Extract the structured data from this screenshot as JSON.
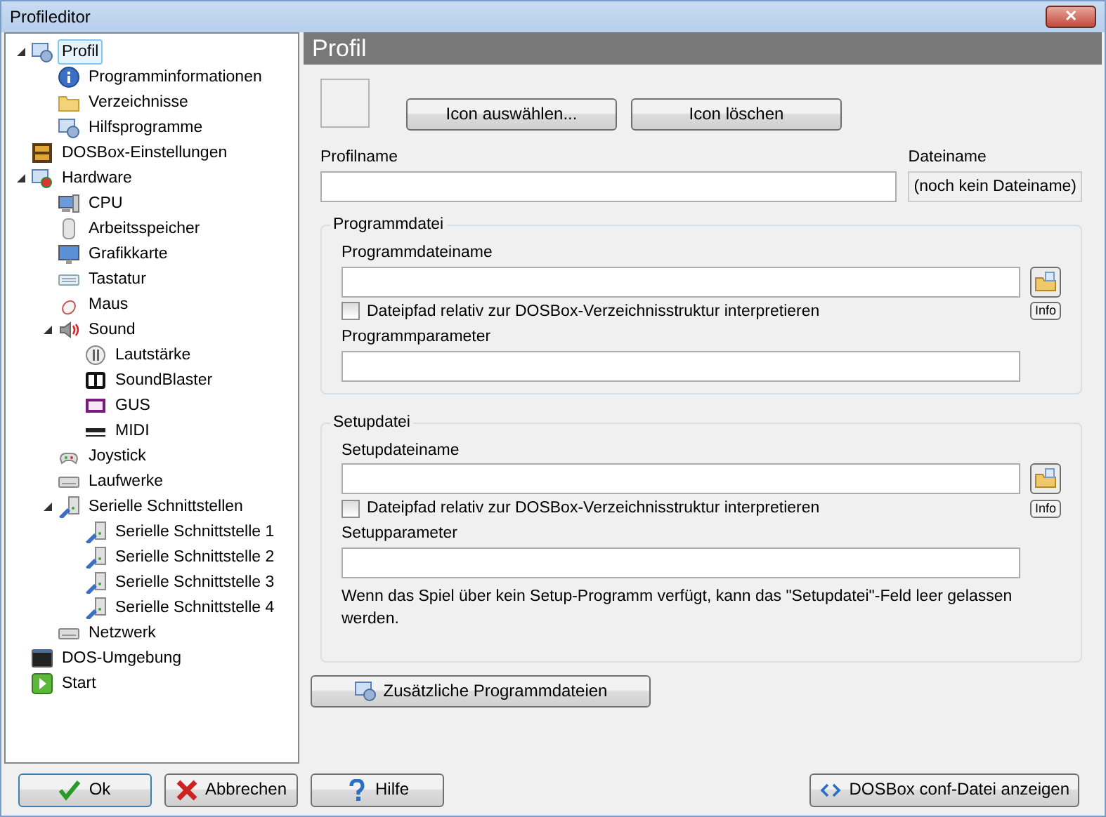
{
  "window": {
    "title": "Profileditor",
    "close_label": "✕"
  },
  "tree": [
    {
      "label": "Profil",
      "kind": "gear",
      "selected": true,
      "expanded": true,
      "children": [
        {
          "label": "Programminformationen",
          "kind": "info",
          "selected": false
        },
        {
          "label": "Verzeichnisse",
          "kind": "folder",
          "selected": false
        },
        {
          "label": "Hilfsprogramme",
          "kind": "gear",
          "selected": false
        }
      ]
    },
    {
      "label": "DOSBox-Einstellungen",
      "kind": "dosbox",
      "selected": false
    },
    {
      "label": "Hardware",
      "kind": "hardware",
      "selected": false,
      "expanded": true,
      "children": [
        {
          "label": "CPU",
          "kind": "computer",
          "selected": false
        },
        {
          "label": "Arbeitsspeicher",
          "kind": "memory",
          "selected": false
        },
        {
          "label": "Grafikkarte",
          "kind": "monitor",
          "selected": false
        },
        {
          "label": "Tastatur",
          "kind": "keyboard",
          "selected": false
        },
        {
          "label": "Maus",
          "kind": "mouse",
          "selected": false
        },
        {
          "label": "Sound",
          "kind": "speaker",
          "selected": false,
          "expanded": true,
          "children": [
            {
              "label": "Lautstärke",
              "kind": "volume",
              "selected": false
            },
            {
              "label": "SoundBlaster",
              "kind": "sb",
              "selected": false
            },
            {
              "label": "GUS",
              "kind": "gus",
              "selected": false
            },
            {
              "label": "MIDI",
              "kind": "midi",
              "selected": false
            }
          ]
        },
        {
          "label": "Joystick",
          "kind": "joystick",
          "selected": false
        },
        {
          "label": "Laufwerke",
          "kind": "drive",
          "selected": false
        },
        {
          "label": "Serielle Schnittstellen",
          "kind": "serial",
          "selected": false,
          "expanded": true,
          "children": [
            {
              "label": "Serielle Schnittstelle 1",
              "kind": "serial",
              "selected": false
            },
            {
              "label": "Serielle Schnittstelle 2",
              "kind": "serial",
              "selected": false
            },
            {
              "label": "Serielle Schnittstelle 3",
              "kind": "serial",
              "selected": false
            },
            {
              "label": "Serielle Schnittstelle 4",
              "kind": "serial",
              "selected": false
            }
          ]
        },
        {
          "label": "Netzwerk",
          "kind": "drive",
          "selected": false
        }
      ]
    },
    {
      "label": "DOS-Umgebung",
      "kind": "console",
      "selected": false
    },
    {
      "label": "Start",
      "kind": "start",
      "selected": false
    }
  ],
  "panel": {
    "title": "Profil",
    "icon_buttons": [
      "Icon auswählen...",
      "Icon löschen"
    ],
    "profile_name_label": "Profilname",
    "file_name_label": "Dateiname",
    "file_name_value": "(noch kein Dateiname)",
    "groups": [
      {
        "title": "Programmdatei",
        "file_label": "Programmdateiname",
        "relative_label": "Dateipfad relativ zur DOSBox-Verzeichnisstruktur interpretieren",
        "relative_checked": false,
        "info_label": "Info",
        "params_label": "Programmparameter"
      },
      {
        "title": "Setupdatei",
        "file_label": "Setupdateiname",
        "relative_label": "Dateipfad relativ zur DOSBox-Verzeichnisstruktur interpretieren",
        "relative_checked": false,
        "info_label": "Info",
        "params_label": "Setupparameter",
        "note": "Wenn das Spiel über kein Setup-Programm verfügt, kann das \"Setupdatei\"-Feld leer gelassen werden."
      }
    ],
    "extra_button": "Zusätzliche Programmdateien"
  },
  "footer": [
    {
      "label": "Ok",
      "kind": "ok"
    },
    {
      "label": "Abbrechen",
      "kind": "cancel"
    },
    {
      "label": "Hilfe",
      "kind": "help"
    },
    {
      "label": "DOSBox conf-Datei anzeigen",
      "kind": "conf"
    }
  ]
}
